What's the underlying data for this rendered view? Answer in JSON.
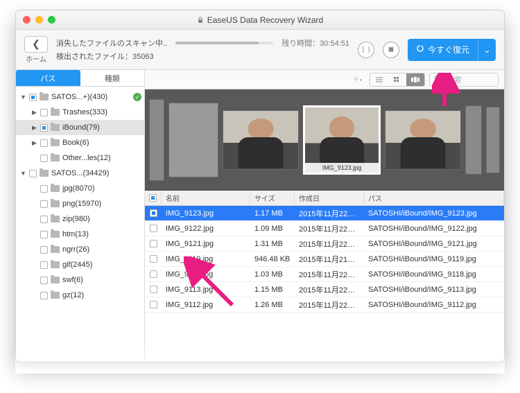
{
  "title": "EaseUS Data Recovery Wizard",
  "home_label": "ホーム",
  "scan": {
    "status": "消失したファイルのスキャン中..",
    "found_label": "検出されたファイル：",
    "found_count": "35063",
    "remaining_label": "残り時間：",
    "remaining_time": "30:54:51"
  },
  "recover_label": "今すぐ復元",
  "tabs": {
    "path": "パス",
    "type": "種類"
  },
  "tree": [
    {
      "indent": 0,
      "disclosure": "▼",
      "checked": true,
      "label": "SATOS...+)(430)",
      "badge": true
    },
    {
      "indent": 1,
      "disclosure": "▶",
      "checked": false,
      "label": "Trashes(333)"
    },
    {
      "indent": 1,
      "disclosure": "▶",
      "checked": true,
      "label": "iBound(79)",
      "selected": true
    },
    {
      "indent": 1,
      "disclosure": "▶",
      "checked": false,
      "label": "Book(6)"
    },
    {
      "indent": 1,
      "disclosure": "",
      "checked": false,
      "label": "Other...les(12)"
    },
    {
      "indent": 0,
      "disclosure": "▼",
      "checked": false,
      "label": "SATOS...(34429)"
    },
    {
      "indent": 1,
      "disclosure": "",
      "checked": false,
      "label": "jpg(8070)"
    },
    {
      "indent": 1,
      "disclosure": "",
      "checked": false,
      "label": "png(15970)"
    },
    {
      "indent": 1,
      "disclosure": "",
      "checked": false,
      "label": "zip(980)"
    },
    {
      "indent": 1,
      "disclosure": "",
      "checked": false,
      "label": "htm(13)"
    },
    {
      "indent": 1,
      "disclosure": "",
      "checked": false,
      "label": "ngrr(26)"
    },
    {
      "indent": 1,
      "disclosure": "",
      "checked": false,
      "label": "gif(2445)"
    },
    {
      "indent": 1,
      "disclosure": "",
      "checked": false,
      "label": "swf(6)"
    },
    {
      "indent": 1,
      "disclosure": "",
      "checked": false,
      "label": "gz(12)"
    }
  ],
  "search_placeholder": "検索",
  "preview_caption": "IMG_9123.jpg",
  "columns": {
    "name": "名前",
    "size": "サイズ",
    "date": "作成日",
    "path": "パス"
  },
  "files": [
    {
      "checked": true,
      "selected": true,
      "name": "IMG_9123.jpg",
      "size": "1.17 MB",
      "date": "2015年11月22日...",
      "path": "SATOSHI/iBound/IMG_9123.jpg"
    },
    {
      "checked": false,
      "selected": false,
      "name": "IMG_9122.jpg",
      "size": "1.09 MB",
      "date": "2015年11月22日...",
      "path": "SATOSHI/iBound/IMG_9122.jpg"
    },
    {
      "checked": false,
      "selected": false,
      "name": "IMG_9121.jpg",
      "size": "1.31 MB",
      "date": "2015年11月22日...",
      "path": "SATOSHI/iBound/IMG_9121.jpg"
    },
    {
      "checked": false,
      "selected": false,
      "name": "IMG_9119.jpg",
      "size": "946.48 KB",
      "date": "2015年11月21日...",
      "path": "SATOSHI/iBound/IMG_9119.jpg"
    },
    {
      "checked": false,
      "selected": false,
      "name": "IMG_9118.jpg",
      "size": "1.03 MB",
      "date": "2015年11月22日...",
      "path": "SATOSHI/iBound/IMG_9118.jpg"
    },
    {
      "checked": false,
      "selected": false,
      "name": "IMG_9113.jpg",
      "size": "1.15 MB",
      "date": "2015年11月22日...",
      "path": "SATOSHI/iBound/IMG_9113.jpg"
    },
    {
      "checked": false,
      "selected": false,
      "name": "IMG_9112.jpg",
      "size": "1.26 MB",
      "date": "2015年11月22日...",
      "path": "SATOSHI/iBound/IMG_9112.jpg"
    }
  ]
}
